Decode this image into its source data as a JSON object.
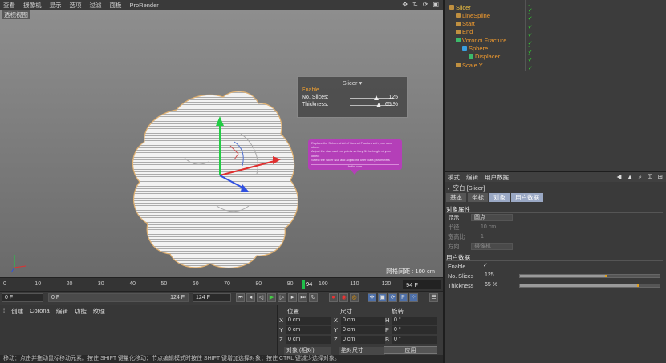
{
  "menubar": {
    "items": [
      "查看",
      "摄像机",
      "显示",
      "选项",
      "过滤",
      "面板",
      "ProRender"
    ]
  },
  "viewport": {
    "label": "透视视图",
    "grid_text": "网格间距 : 100 cm"
  },
  "slicer_hud": {
    "title": "Slicer",
    "enable_label": "Enable",
    "slices_label": "No. Slices:",
    "slices_value": "125",
    "slices_level": 0.6,
    "thickness_label": "Thickness:",
    "thickness_value": "65 %",
    "thickness_level": 0.65
  },
  "tooltip": {
    "lines": [
      "Replace the Sphere child of Voronoi Fracture with your own object",
      "Adjust the start and end points so they fit the height of your object",
      "Select the Slicer Null and adjust the user Data parameters"
    ],
    "footer": "fattiot.com"
  },
  "objects": [
    {
      "name": "Slicer",
      "indent": 0,
      "color": "#f0c040"
    },
    {
      "name": "LineSpline",
      "indent": 1,
      "color": "#f09a2e"
    },
    {
      "name": "Start",
      "indent": 1,
      "color": "#f09a2e"
    },
    {
      "name": "End",
      "indent": 1,
      "color": "#f09a2e"
    },
    {
      "name": "Voronoi Fracture",
      "indent": 1,
      "color": "#f09a2e"
    },
    {
      "name": "Sphere",
      "indent": 2,
      "color": "#f09a2e"
    },
    {
      "name": "Displacer",
      "indent": 3,
      "color": "#f09a2e"
    },
    {
      "name": "Scale Y",
      "indent": 1,
      "color": "#f09a2e"
    }
  ],
  "attributes": {
    "menu": [
      "模式",
      "编辑",
      "用户数据"
    ],
    "title": "空白 [Slicer]",
    "tabs": [
      "基本",
      "坐标",
      "对象",
      "用户数据"
    ],
    "object_section": "对象属性",
    "display_label": "显示",
    "display_value": "圆点",
    "radius_label": "半径",
    "radius_value": "10 cm",
    "aspect_label": "宽高比",
    "aspect_value": "1",
    "orientation_label": "方向",
    "orientation_value": "摄像机",
    "user_section": "用户数据",
    "enable_label": "Enable",
    "enable_check": "✓",
    "slices_label": "No. Slices",
    "slices_value": "125",
    "slices_level": 0.62,
    "thickness_label": "Thickness",
    "thickness_value": "65 %",
    "thickness_level": 0.85
  },
  "timeline": {
    "ticks": [
      "0",
      "10",
      "20",
      "30",
      "40",
      "50",
      "60",
      "70",
      "80",
      "90",
      "100",
      "110",
      "120"
    ],
    "current_frame": "94",
    "frame_box": "94 F"
  },
  "transport": {
    "start_field": "0 F",
    "range_start": "0 F",
    "range_end": "124 F",
    "end_field": "124 F"
  },
  "materials": {
    "menu": [
      "创建",
      "Corona",
      "编辑",
      "功能",
      "纹理"
    ]
  },
  "coords": {
    "heads": [
      "位置",
      "尺寸",
      "旋转"
    ],
    "rows": [
      {
        "a": "X",
        "av": "0 cm",
        "b": "X",
        "bv": "0 cm",
        "c": "H",
        "cv": "0 °"
      },
      {
        "a": "Y",
        "av": "0 cm",
        "b": "Y",
        "bv": "0 cm",
        "c": "P",
        "cv": "0 °"
      },
      {
        "a": "Z",
        "av": "0 cm",
        "b": "Z",
        "bv": "0 cm",
        "c": "B",
        "cv": "0 °"
      }
    ],
    "mode1": "对象 (相对)",
    "mode2": "绝对尺寸",
    "apply": "应用"
  },
  "statusbar": "移动：点击并拖动鼠标移动元素。按住 SHIFT 键量化移动；节点编辑模式时按住 SHIFT 键增加选择对象；按住 CTRL 键减少选择对象。"
}
